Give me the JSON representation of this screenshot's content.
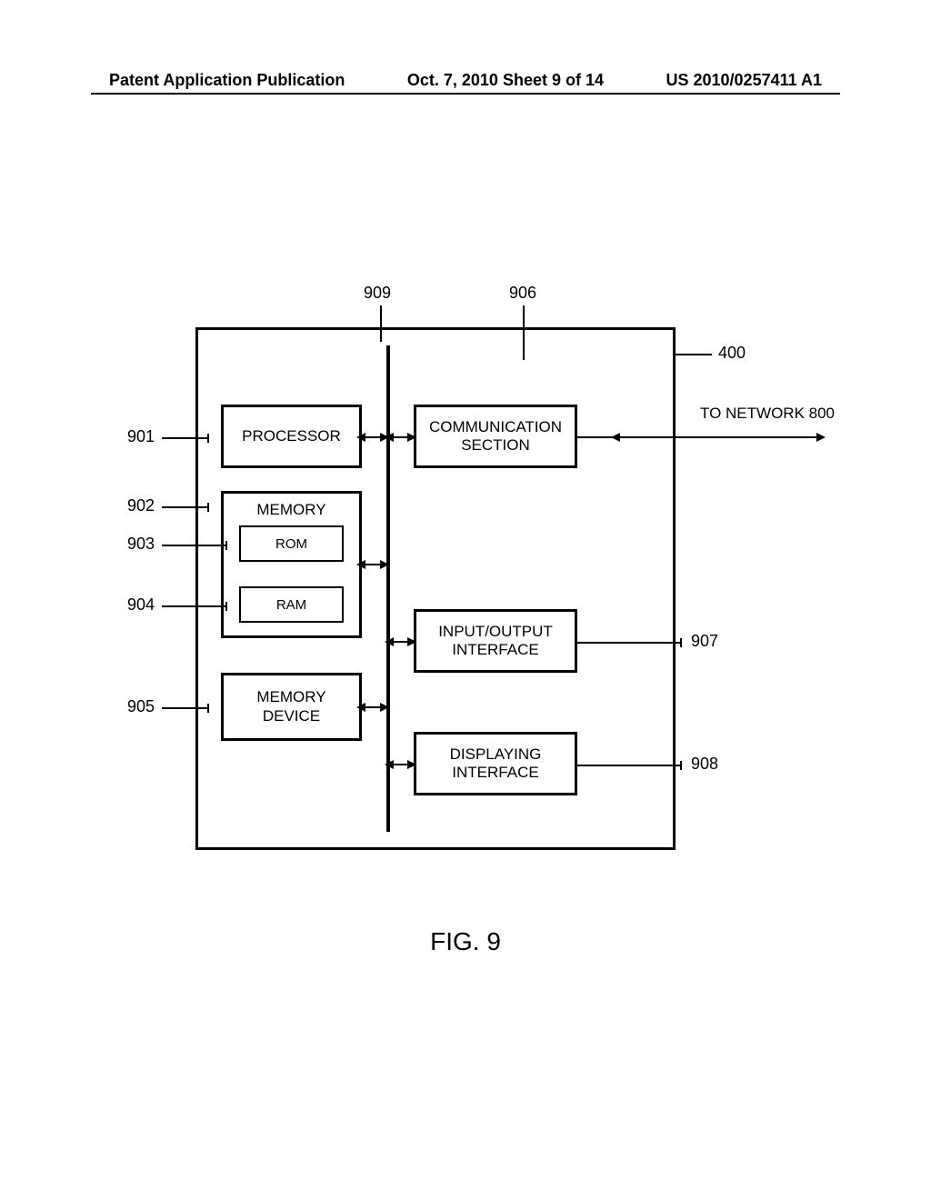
{
  "header": {
    "left": "Patent Application Publication",
    "center": "Oct. 7, 2010  Sheet 9 of 14",
    "right": "US 2010/0257411 A1"
  },
  "labels": {
    "ref909": "909",
    "ref906": "906",
    "ref400": "400",
    "ref901": "901",
    "ref902": "902",
    "ref903": "903",
    "ref904": "904",
    "ref905": "905",
    "ref907": "907",
    "ref908": "908",
    "to_network": "TO NETWORK 800"
  },
  "blocks": {
    "processor": "PROCESSOR",
    "memory": "MEMORY",
    "rom": "ROM",
    "ram": "RAM",
    "memory_device": "MEMORY\nDEVICE",
    "comm": "COMMUNICATION\nSECTION",
    "io": "INPUT/OUTPUT\nINTERFACE",
    "display": "DISPLAYING\nINTERFACE"
  },
  "figure": "FIG. 9"
}
